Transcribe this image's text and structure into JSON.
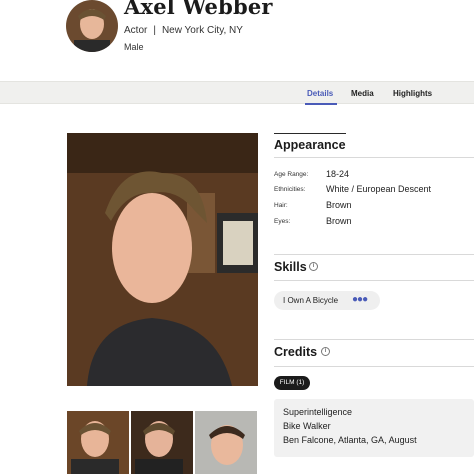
{
  "profile": {
    "name": "Axel Webber",
    "role": "Actor",
    "separator": "|",
    "location": "New York City, NY",
    "gender": "Male"
  },
  "tabs": [
    {
      "label": "Details",
      "active": true
    },
    {
      "label": "Media",
      "active": false
    },
    {
      "label": "Highlights",
      "active": false
    }
  ],
  "appearance": {
    "title": "Appearance",
    "rows": [
      {
        "label": "Age Range:",
        "value": "18-24"
      },
      {
        "label": "Ethnicities:",
        "value": "White / European Descent"
      },
      {
        "label": "Hair:",
        "value": "Brown"
      },
      {
        "label": "Eyes:",
        "value": "Brown"
      }
    ]
  },
  "skills": {
    "title": "Skills",
    "items": [
      "I Own A Bicycle"
    ],
    "more_icon": "more-dots-icon"
  },
  "credits": {
    "title": "Credits",
    "filter_chip": "FILM (1)",
    "entry": {
      "title": "Superintelligence",
      "role": "Bike Walker",
      "details": "Ben Falcone, Atlanta, GA, August"
    }
  },
  "icons": {
    "help": "info-circle-icon"
  },
  "colors": {
    "accent": "#4a5bb8",
    "tabbar_bg": "#f0f0ee",
    "chip_bg": "#1b1b1b",
    "card_bg": "#f1f1f1"
  }
}
